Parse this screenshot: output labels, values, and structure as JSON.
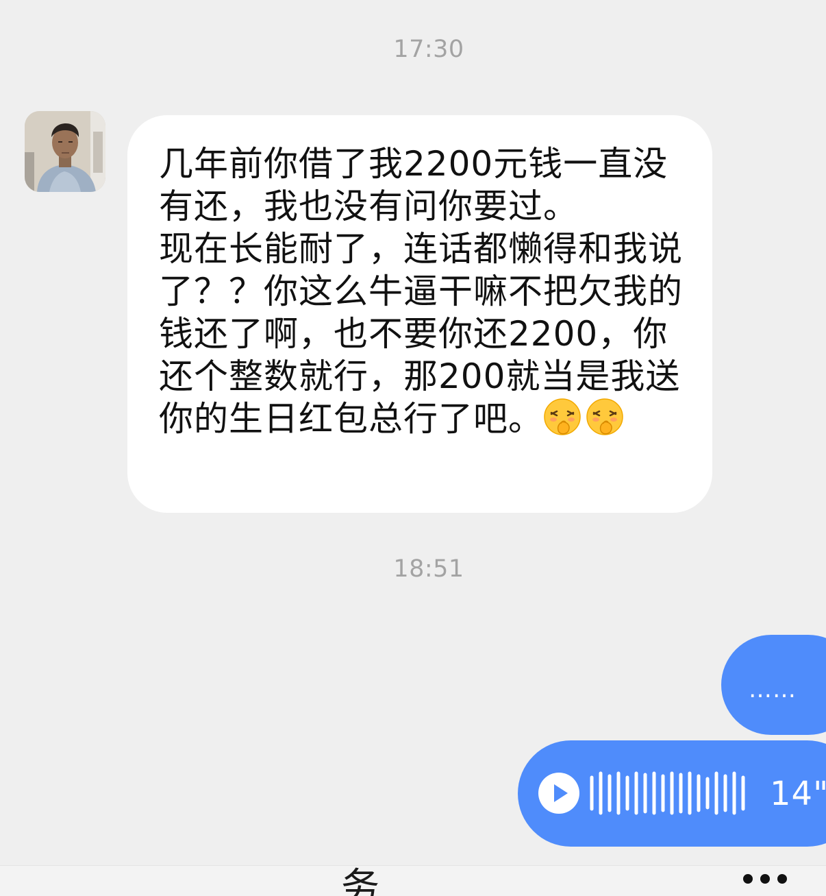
{
  "timestamps": [
    "17:30",
    "18:51"
  ],
  "contact": {
    "avatar_icon": "contact-avatar-photo"
  },
  "incoming_message": {
    "text": "几年前你借了我2200元钱一直没有还，我也没有问你要过。\n现在长能耐了，连话都懒得和我说了？？你这么牛逼干嘛不把欠我的钱还了啊，也不要你还2200，你还个整数就行，那200就当是我送你的生日红包总行了吧。",
    "emojis": [
      "face-with-hand-over-mouth-icon",
      "face-with-hand-over-mouth-icon"
    ]
  },
  "outgoing_text": {
    "text": "……"
  },
  "voice_message": {
    "duration": "14\"",
    "icon": "play-icon"
  },
  "bottom_bar": {
    "partial_label": "务",
    "more_icon": "more-dots-icon"
  },
  "colors": {
    "background": "#efefef",
    "incoming_bubble": "#ffffff",
    "outgoing_bubble": "#4f8cfb",
    "timestamp": "#a3a3a3"
  }
}
